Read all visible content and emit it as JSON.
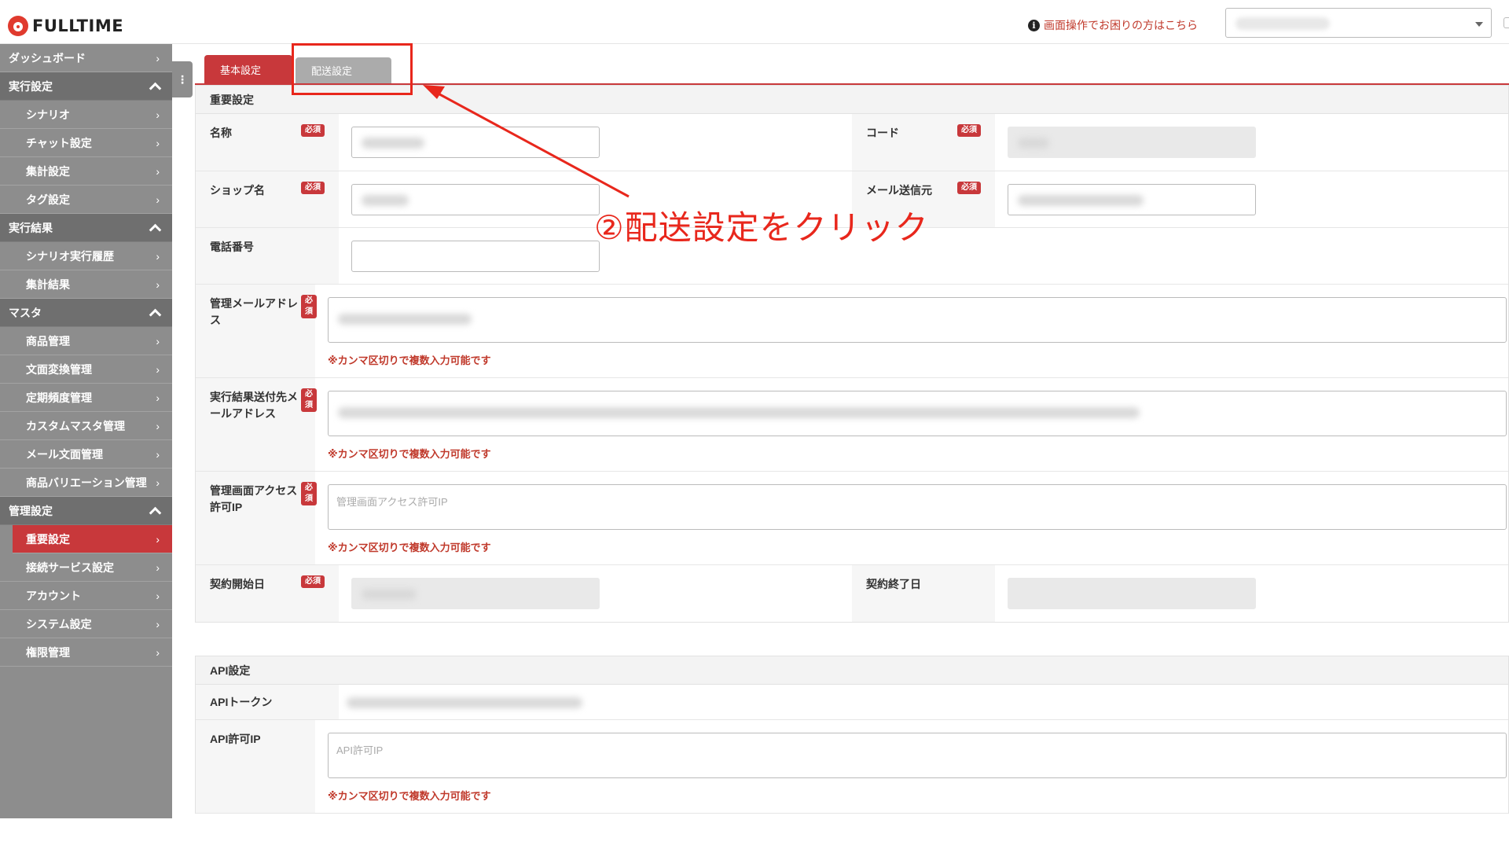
{
  "header": {
    "logo_text": "FULLTIME",
    "help_link": "画面操作でお困りの方はこちら"
  },
  "sidebar": {
    "toggle_label": "⋮",
    "items": [
      {
        "type": "item",
        "label": "ダッシュボード",
        "top": true
      },
      {
        "type": "group",
        "label": "実行設定"
      },
      {
        "type": "item",
        "label": "シナリオ"
      },
      {
        "type": "item",
        "label": "チャット設定"
      },
      {
        "type": "item",
        "label": "集計設定"
      },
      {
        "type": "item",
        "label": "タグ設定"
      },
      {
        "type": "group",
        "label": "実行結果"
      },
      {
        "type": "item",
        "label": "シナリオ実行履歴"
      },
      {
        "type": "item",
        "label": "集計結果"
      },
      {
        "type": "group",
        "label": "マスタ"
      },
      {
        "type": "item",
        "label": "商品管理"
      },
      {
        "type": "item",
        "label": "文面変換管理"
      },
      {
        "type": "item",
        "label": "定期頻度管理"
      },
      {
        "type": "item",
        "label": "カスタムマスタ管理"
      },
      {
        "type": "item",
        "label": "メール文面管理"
      },
      {
        "type": "item",
        "label": "商品バリエーション管理"
      },
      {
        "type": "group",
        "label": "管理設定"
      },
      {
        "type": "item",
        "label": "重要設定",
        "active": true
      },
      {
        "type": "item",
        "label": "接続サービス設定"
      },
      {
        "type": "item",
        "label": "アカウント"
      },
      {
        "type": "item",
        "label": "システム設定"
      },
      {
        "type": "item",
        "label": "権限管理"
      }
    ]
  },
  "tabs": {
    "basic": "基本設定",
    "delivery": "配送設定"
  },
  "important": {
    "title": "重要設定",
    "required_badge": "必須",
    "name_label": "名称",
    "code_label": "コード",
    "shop_label": "ショップ名",
    "mail_from_label": "メール送信元",
    "phone_label": "電話番号",
    "admin_mail_label": "管理メールアドレス",
    "result_mail_label": "実行結果送付先メールアドレス",
    "admin_ip_label": "管理画面アクセス許可IP",
    "admin_ip_placeholder": "管理画面アクセス許可IP",
    "contract_start_label": "契約開始日",
    "contract_end_label": "契約終了日",
    "comma_note": "※カンマ区切りで複数入力可能です"
  },
  "api": {
    "title": "API設定",
    "token_label": "APIトークン",
    "ip_label": "API許可IP",
    "ip_placeholder": "API許可IP",
    "comma_note": "※カンマ区切りで複数入力可能です"
  },
  "annotation": {
    "text": "②配送設定をクリック",
    "color": "#e8271c"
  },
  "colors": {
    "accent": "#c8383b",
    "sidebar": "#8d8d8d",
    "sidebar_group": "#6f6f6f"
  }
}
